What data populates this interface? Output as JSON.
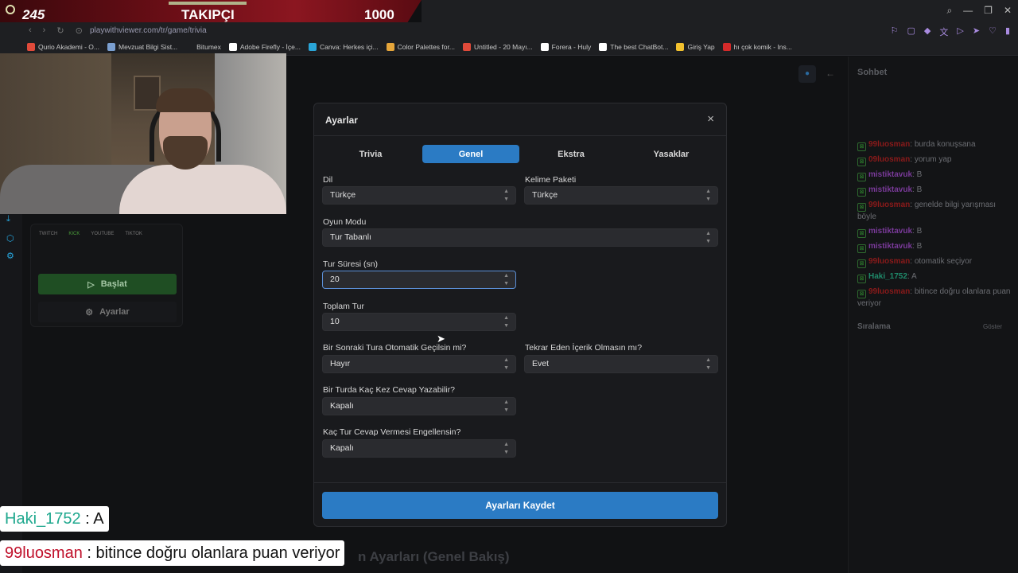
{
  "overlay": {
    "count_left": "245",
    "label": "TAKIPÇI",
    "count_right": "1000"
  },
  "browser": {
    "url": "playwithviewer.com/tr/game/trivia",
    "bookmarks": [
      {
        "label": "Qurio Akademi - O...",
        "color": "#e04a3a"
      },
      {
        "label": "Mevzuat Bilgi Sist...",
        "color": "#7a9fd0"
      },
      {
        "label": "Bitumex",
        "color": ""
      },
      {
        "label": "Adobe Firefly - İçe...",
        "color": "#ffffff"
      },
      {
        "label": "Canva: Herkes içi...",
        "color": "#2aa5d8"
      },
      {
        "label": "Color Palettes for...",
        "color": "#e5a53a"
      },
      {
        "label": "Untitled - 20 Mayı...",
        "color": "#e04a3a"
      },
      {
        "label": "Forera - Huly",
        "color": "#ffffff"
      },
      {
        "label": "The best ChatBot...",
        "color": "#ffffff"
      },
      {
        "label": "Giriş Yap",
        "color": "#f2c12e"
      },
      {
        "label": "hı çok komik - Ins...",
        "color": "#d42a2a"
      }
    ]
  },
  "game_panel": {
    "platforms": [
      "TWITCH",
      "KICK",
      "YOUTUBE",
      "TIKTOK"
    ],
    "start_label": "Başlat",
    "settings_label": "Ayarlar"
  },
  "page": {
    "bottom_heading": "n Ayarları (Genel Bakış)"
  },
  "chat": {
    "title": "Sohbet",
    "messages": [
      {
        "user": "99luosman",
        "text": "burda konuşsana",
        "color": "#8a1a1a"
      },
      {
        "user": "09luosman",
        "text": "yorum yap",
        "color": "#8a1a1a"
      },
      {
        "user": "mistiktavuk",
        "text": "B",
        "color": "#7a3a9a"
      },
      {
        "user": "mistiktavuk",
        "text": "B",
        "color": "#7a3a9a"
      },
      {
        "user": "99luosman",
        "text": "genelde bilgi yarışması böyle",
        "color": "#8a1a1a"
      },
      {
        "user": "mistiktavuk",
        "text": "B",
        "color": "#7a3a9a"
      },
      {
        "user": "mistiktavuk",
        "text": "B",
        "color": "#7a3a9a"
      },
      {
        "user": "99luosman",
        "text": "otomatik seçiyor",
        "color": "#8a1a1a"
      },
      {
        "user": "Haki_1752",
        "text": "A",
        "color": "#1f8a6a"
      },
      {
        "user": "99luosman",
        "text": "bitince doğru olanlara puan veriyor",
        "color": "#8a1a1a"
      }
    ],
    "ranking_title": "Sıralama",
    "ranking_show": "Göster"
  },
  "stream_chat": [
    {
      "user": "Haki_1752",
      "text": " : A"
    },
    {
      "user": "99luosman",
      "text": " : bitince doğru olanlara puan veriyor"
    }
  ],
  "modal": {
    "title": "Ayarlar",
    "close": "×",
    "tabs": [
      "Trivia",
      "Genel",
      "Ekstra",
      "Yasaklar"
    ],
    "active_tab": "Genel",
    "fields": {
      "dil": {
        "label": "Dil",
        "value": "Türkçe"
      },
      "kelime": {
        "label": "Kelime Paketi",
        "value": "Türkçe"
      },
      "oyun_modu": {
        "label": "Oyun Modu",
        "value": "Tur Tabanlı"
      },
      "tur_suresi": {
        "label": "Tur Süresi (sn)",
        "value": "20"
      },
      "toplam_tur": {
        "label": "Toplam Tur",
        "value": "10"
      },
      "oto_gecis": {
        "label": "Bir Sonraki Tura Otomatik Geçilsin mi?",
        "value": "Hayır"
      },
      "tekrar": {
        "label": "Tekrar Eden İçerik Olmasın mı?",
        "value": "Evet"
      },
      "cevap_sayi": {
        "label": "Bir Turda Kaç Kez Cevap Yazabilir?",
        "value": "Kapalı"
      },
      "engel": {
        "label": "Kaç Tur Cevap Vermesi Engellensin?",
        "value": "Kapalı"
      }
    },
    "save_label": "Ayarları Kaydet"
  },
  "colors": {
    "accent": "#2b7bc4",
    "modal_bg": "#191a1d",
    "page_bg": "#111214"
  }
}
